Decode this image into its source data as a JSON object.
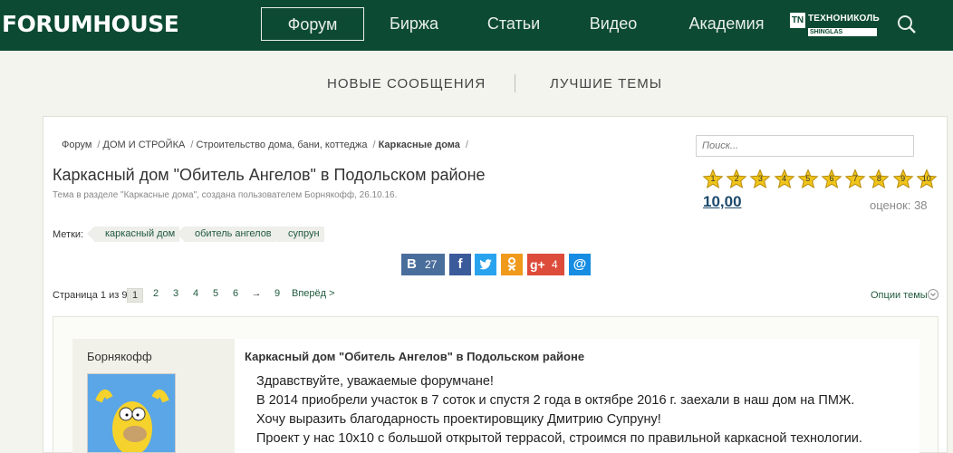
{
  "header": {
    "logo": "FORUMHOUSE",
    "nav": [
      "Форум",
      "Биржа",
      "Статьи",
      "Видео",
      "Академия"
    ],
    "partner_badge": "TN",
    "partner_name": "ТЕХНОНИКОЛЬ",
    "partner_sub": "SHINGLAS",
    "search_icon": "search-icon"
  },
  "subnav": {
    "new_messages": "НОВЫЕ СООБЩЕНИЯ",
    "best_topics": "ЛУЧШИЕ ТЕМЫ"
  },
  "breadcrumbs": [
    "Форум",
    "ДОМ И СТРОЙКА",
    "Строительство дома, бани, коттеджа",
    "Каркасные дома"
  ],
  "search": {
    "placeholder": "Поиск..."
  },
  "thread": {
    "title": "Каркасный дом \"Обитель Ангелов\" в Подольском районе",
    "subtitle": "Тема в разделе \"Каркасные дома\", создана пользователем Борнякофф, 26.10.16."
  },
  "rating": {
    "stars": [
      "1",
      "2",
      "3",
      "4",
      "5",
      "6",
      "7",
      "8",
      "9",
      "10"
    ],
    "value": "10,00",
    "votes": "оценок: 38"
  },
  "tags": {
    "label": "Метки:",
    "items": [
      "каркасный дом",
      "обитель ангелов",
      "супрун"
    ]
  },
  "share": {
    "vk_count": "27",
    "gplus_count": "4"
  },
  "pagination": {
    "label": "Страница 1 из 9",
    "pages": [
      "1",
      "2",
      "3",
      "4",
      "5",
      "6",
      "→",
      "9"
    ],
    "next": "Вперёд >"
  },
  "options": "Опции темы",
  "post": {
    "username": "Борнякофф",
    "title": "Каркасный дом \"Обитель Ангелов\" в Подольском районе",
    "lines": [
      "Здравствуйте, уважаемые форумчане!",
      "В 2014 приобрели участок в 7 соток и спустя 2 года в октябре 2016 г. заехали в наш дом на ПМЖ.",
      "Хочу выразить благодарность проектировщику Дмитрию Супруну!",
      "Проект у нас 10х10 с большой открытой террасой, строимся по правильной каркасной технологии."
    ]
  },
  "colors": {
    "header_bg": "#0d4a34",
    "link": "#1f5a3e",
    "star": "#f0c419"
  }
}
